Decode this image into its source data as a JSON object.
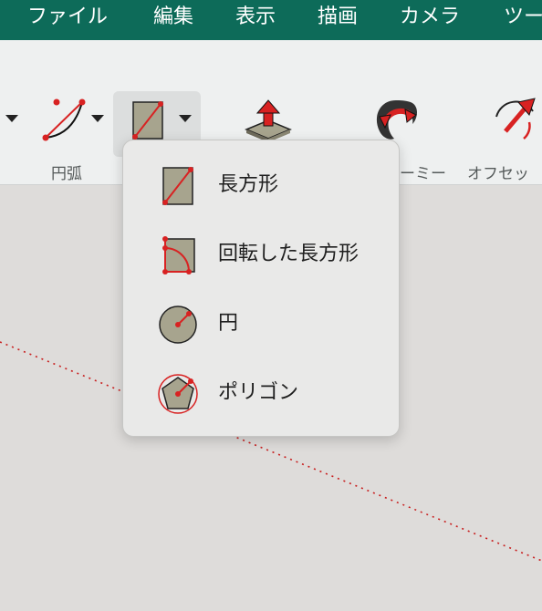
{
  "menubar": {
    "items": [
      {
        "label": "ファイル"
      },
      {
        "label": "編集"
      },
      {
        "label": "表示"
      },
      {
        "label": "描画"
      },
      {
        "label": "カメラ"
      },
      {
        "label": "ツー"
      }
    ]
  },
  "toolbar": {
    "arc_label": "円弧",
    "orbit_label": "ーミー",
    "offset_label": "オフセッ"
  },
  "dropdown": {
    "items": [
      {
        "label": "長方形",
        "icon": "rectangle-icon"
      },
      {
        "label": "回転した長方形",
        "icon": "rotated-rectangle-icon"
      },
      {
        "label": "円",
        "icon": "circle-icon"
      },
      {
        "label": "ポリゴン",
        "icon": "polygon-icon"
      }
    ]
  },
  "colors": {
    "menubar_bg": "#0d6b59",
    "accent_red": "#d82222",
    "shape_fill": "#a7a48e"
  }
}
